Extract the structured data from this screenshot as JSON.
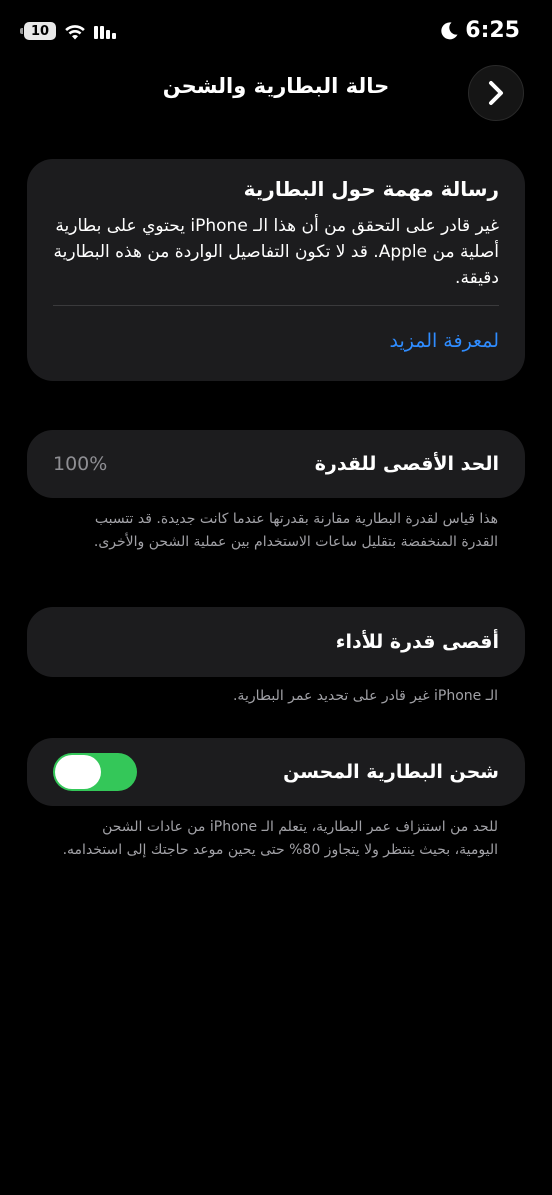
{
  "status_bar": {
    "battery_level": "10",
    "time": "6:25"
  },
  "nav": {
    "title": "حالة البطارية والشحن"
  },
  "alert": {
    "title": "رسالة مهمة حول البطارية",
    "body": "غير قادر على التحقق من أن هذا الـ iPhone يحتوي على بطارية أصلية من Apple. قد لا تكون التفاصيل الواردة من هذه البطارية دقيقة.",
    "link": "لمعرفة المزيد"
  },
  "max_capacity": {
    "label": "الحد الأقصى للقدرة",
    "value": "100%",
    "footnote": "هذا قياس لقدرة البطارية مقارنة بقدرتها عندما كانت جديدة. قد تتسبب القدرة المنخفضة بتقليل ساعات الاستخدام بين عملية الشحن والأخرى."
  },
  "peak_performance": {
    "label": "أقصى قدرة للأداء",
    "footnote": "الـ iPhone غير قادر على تحديد عمر البطارية."
  },
  "optimized_charging": {
    "label": "شحن البطارية المحسن",
    "enabled": true,
    "footnote": "للحد من استنزاف عمر البطارية، يتعلم الـ iPhone من عادات الشحن اليومية، بحيث ينتظر ولا يتجاوز 80% حتى يحين موعد حاجتك إلى استخدامه."
  },
  "colors": {
    "background": "#000000",
    "card": "#1c1c1e",
    "link": "#2f8cff",
    "toggle_on": "#34c759",
    "secondary_text": "#8e8e93"
  },
  "icons": {
    "back": "chevron-right-icon",
    "wifi": "wifi-icon",
    "signal": "cellular-signal-icon",
    "moon": "moon-icon",
    "battery": "battery-icon"
  }
}
